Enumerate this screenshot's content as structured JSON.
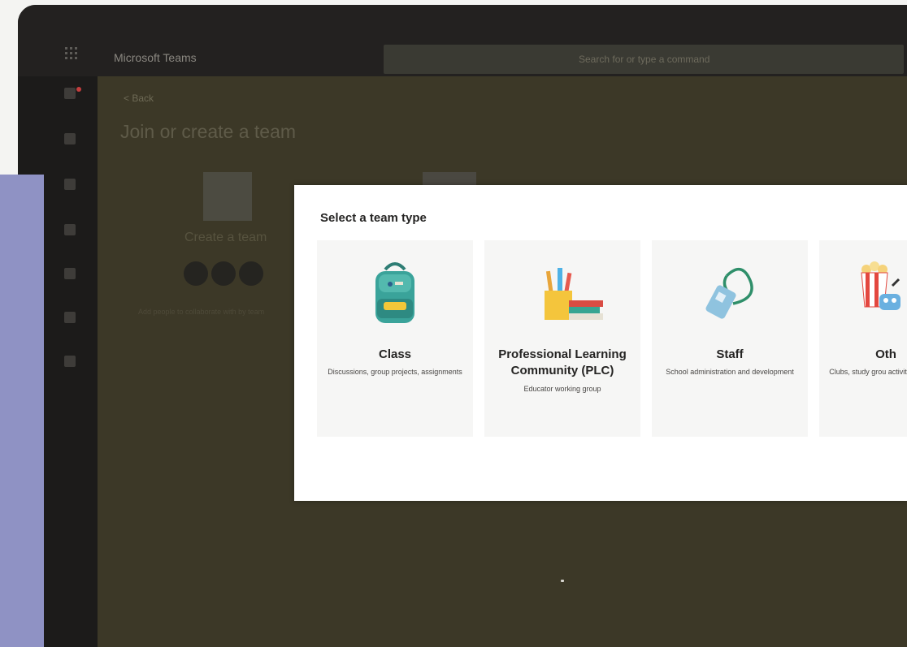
{
  "window": {
    "app_title": "Microsoft Teams",
    "search_placeholder": "Search for or type a command"
  },
  "rail": {
    "icons": [
      "activity-icon",
      "chat-icon",
      "teams-icon",
      "assignments-icon",
      "calendar-icon",
      "calls-icon",
      "files-icon"
    ]
  },
  "background_page": {
    "back_label": "< Back",
    "title": "Join or create a team",
    "create_label": "Create a team",
    "join_hint": "Add people to collaborate with by team"
  },
  "dialog": {
    "title": "Select a team type",
    "cards": [
      {
        "title": "Class",
        "description": "Discussions, group projects, assignments",
        "icon": "backpack-icon"
      },
      {
        "title": "Professional Learning Community (PLC)",
        "description": "Educator working group",
        "icon": "pencil-cup-icon"
      },
      {
        "title": "Staff",
        "description": "School administration and development",
        "icon": "lanyard-badge-icon"
      },
      {
        "title": "Oth",
        "description": "Clubs, study grou activit",
        "icon": "popcorn-icon"
      }
    ]
  },
  "colors": {
    "dim_overlay": "#3c3827",
    "dialog_bg": "#ffffff",
    "card_bg": "#f6f6f5",
    "accent_lavender": "#8f92c4"
  }
}
